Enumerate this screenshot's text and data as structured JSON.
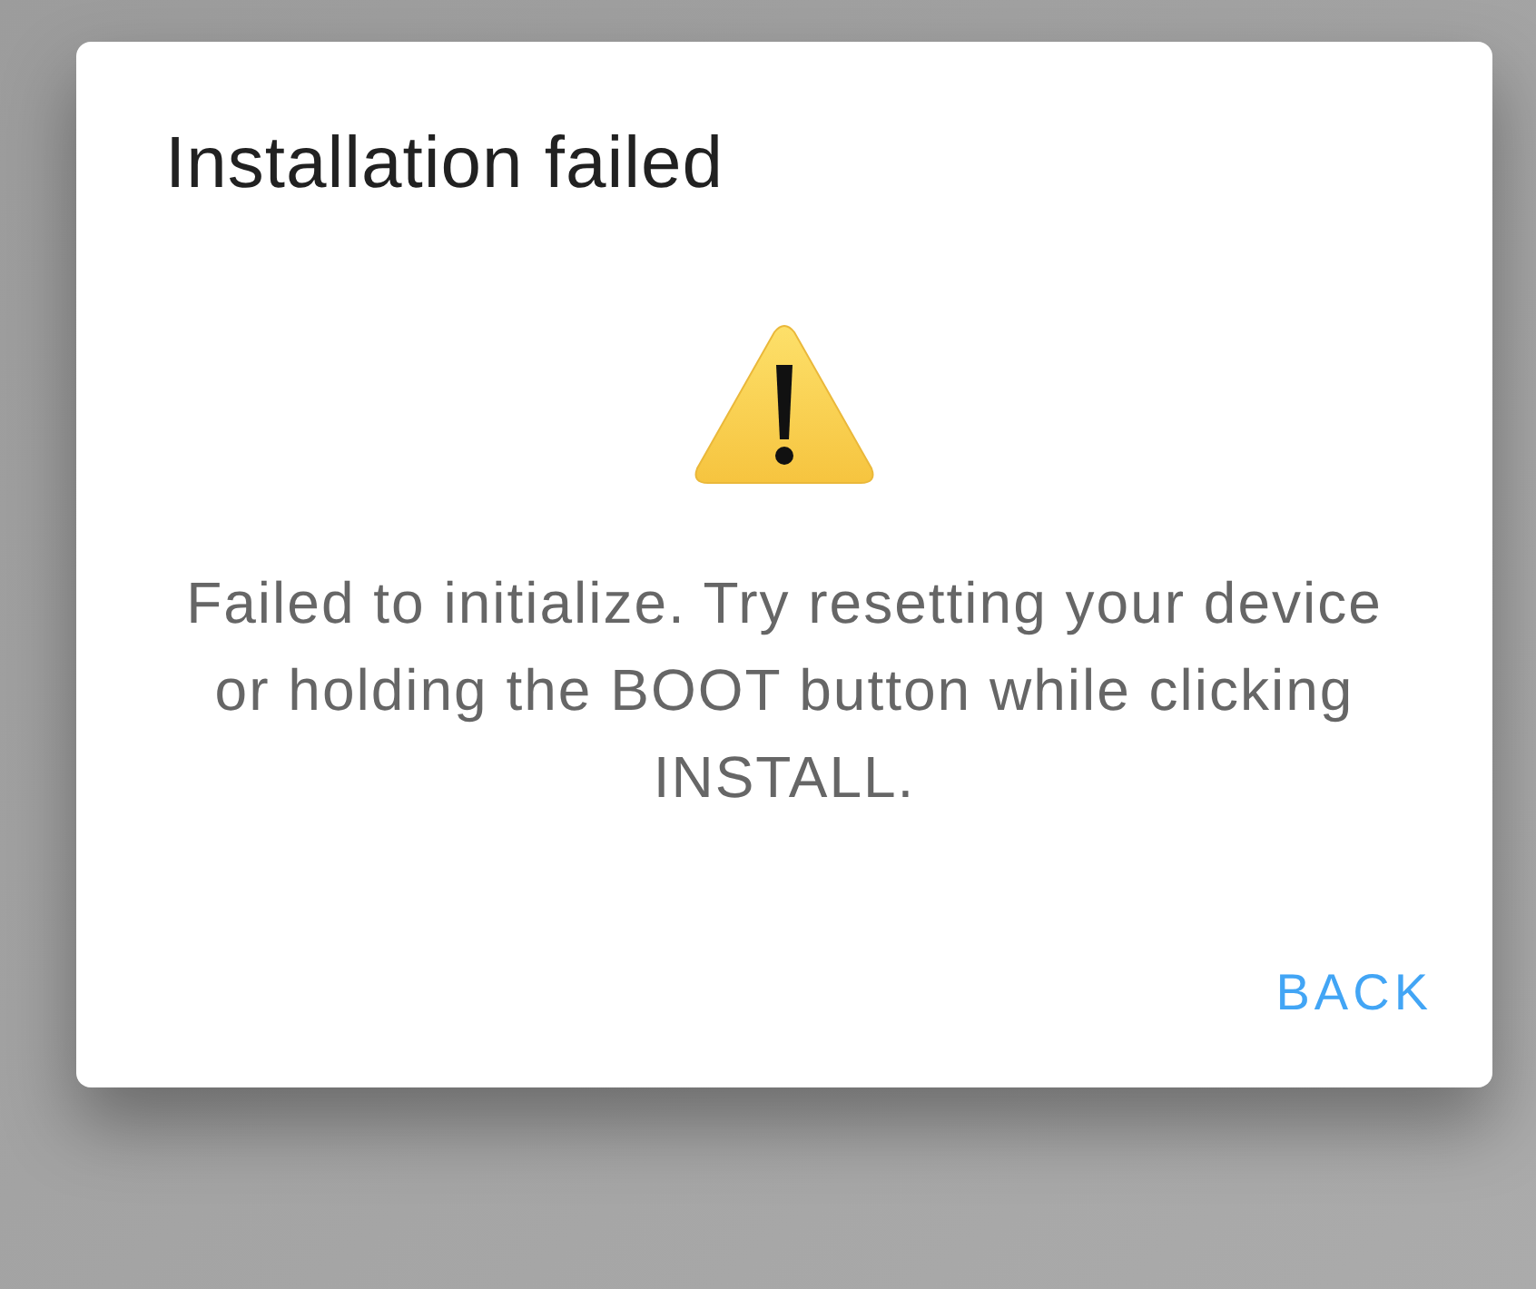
{
  "dialog": {
    "title": "Installation failed",
    "message": "Failed to initialize. Try resetting your device or holding the BOOT button while clicking INSTALL.",
    "buttons": [
      {
        "label": "BACK"
      }
    ]
  }
}
